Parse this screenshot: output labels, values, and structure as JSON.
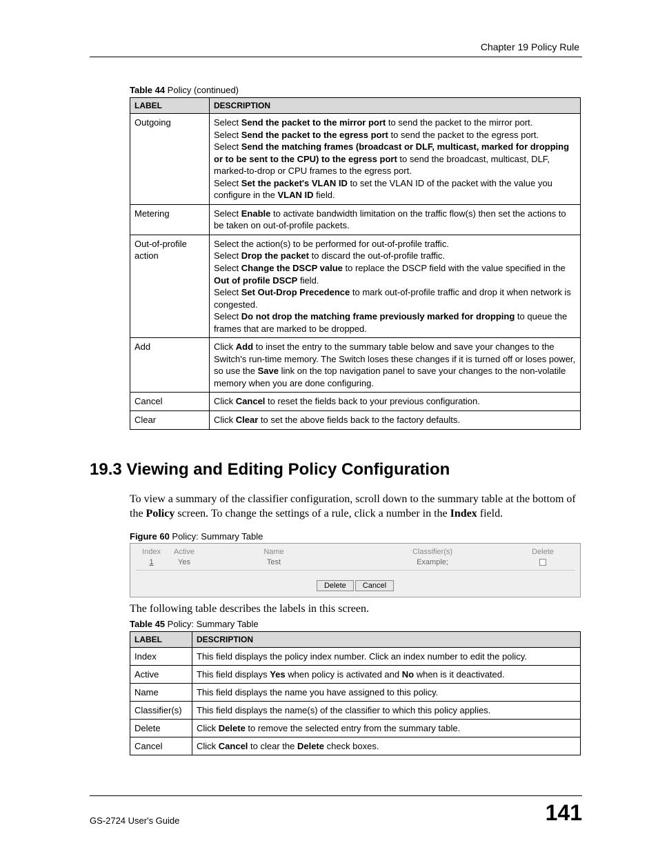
{
  "header": {
    "chapter": "Chapter 19 Policy Rule"
  },
  "table44": {
    "caption_label": "Table 44",
    "caption_rest": "   Policy (continued)",
    "head_label": "LABEL",
    "head_desc": "DESCRIPTION",
    "rows": [
      {
        "label": "Outgoing",
        "desc": "Select <b>Send the packet to the mirror port</b> to send the packet to the mirror port.<br>Select <b>Send the packet to the egress port</b> to send the packet to the egress port.<br>Select <b>Send the matching frames (broadcast or DLF, multicast, marked for dropping or to be sent to the CPU) to the egress port</b> to send the broadcast, multicast, DLF, marked-to-drop or CPU frames to the egress port.<br>Select <b>Set the packet's VLAN ID</b> to set the VLAN ID of the packet with the value you configure in the <b>VLAN ID</b> field."
      },
      {
        "label": "Metering",
        "desc": "Select <b>Enable</b> to activate bandwidth limitation on the traffic flow(s) then set the actions to be taken on out-of-profile packets."
      },
      {
        "label": "Out-of-profile action",
        "desc": "Select the action(s) to be performed for out-of-profile traffic.<br>Select <b>Drop the packet</b> to discard the out-of-profile traffic.<br>Select <b>Change the DSCP value</b> to replace the DSCP field with the value specified in the <b>Out of profile DSCP</b> field.<br>Select <b>Set Out-Drop Precedence</b> to mark out-of-profile traffic and drop it when network is congested.<br>Select <b>Do not drop the matching frame previously marked for dropping</b> to queue the frames that are marked to be dropped."
      },
      {
        "label": "Add",
        "desc": "Click <b>Add</b> to inset the entry to the summary table below and save your changes to the Switch's run-time memory. The Switch loses these changes if it is turned off or loses power, so use the <b>Save</b> link on the top navigation panel to save your changes to the non-volatile memory when you are done configuring."
      },
      {
        "label": "Cancel",
        "desc": "Click <b>Cancel</b> to reset the fields back to your previous configuration."
      },
      {
        "label": "Clear",
        "desc": "Click <b>Clear</b> to set the above fields back to the factory defaults."
      }
    ]
  },
  "section": {
    "heading": "19.3  Viewing and Editing Policy Configuration",
    "para": "To view a summary of the classifier configuration, scroll down to the summary table at the bottom of the <b>Policy</b> screen. To change the settings of a rule, click a number in the <b>Index</b> field."
  },
  "figure60": {
    "caption_label": "Figure 60",
    "caption_rest": "   Policy: Summary Table",
    "head_index": "Index",
    "head_active": "Active",
    "head_name": "Name",
    "head_class": "Classifier(s)",
    "head_delete": "Delete",
    "row_index": "1",
    "row_active": "Yes",
    "row_name": "Test",
    "row_class": "Example;",
    "btn_delete": "Delete",
    "btn_cancel": "Cancel"
  },
  "para_following": "The following table describes the labels in this screen.",
  "table45": {
    "caption_label": "Table 45",
    "caption_rest": "   Policy: Summary Table",
    "head_label": "LABEL",
    "head_desc": "DESCRIPTION",
    "rows": [
      {
        "label": "Index",
        "desc": "This field displays the policy index number. Click an index number to edit the policy."
      },
      {
        "label": "Active",
        "desc": "This field displays <b>Yes</b> when policy is activated and <b>No</b> when is it deactivated."
      },
      {
        "label": "Name",
        "desc": "This field displays the name you have assigned to this policy."
      },
      {
        "label": "Classifier(s)",
        "desc": "This field displays the name(s) of the classifier to which this policy applies."
      },
      {
        "label": "Delete",
        "desc": "Click <b>Delete</b> to remove the selected entry from the summary table."
      },
      {
        "label": "Cancel",
        "desc": "Click <b>Cancel</b> to clear the <b>Delete</b> check boxes."
      }
    ]
  },
  "footer": {
    "guide": "GS-2724 User's Guide",
    "page": "141"
  }
}
